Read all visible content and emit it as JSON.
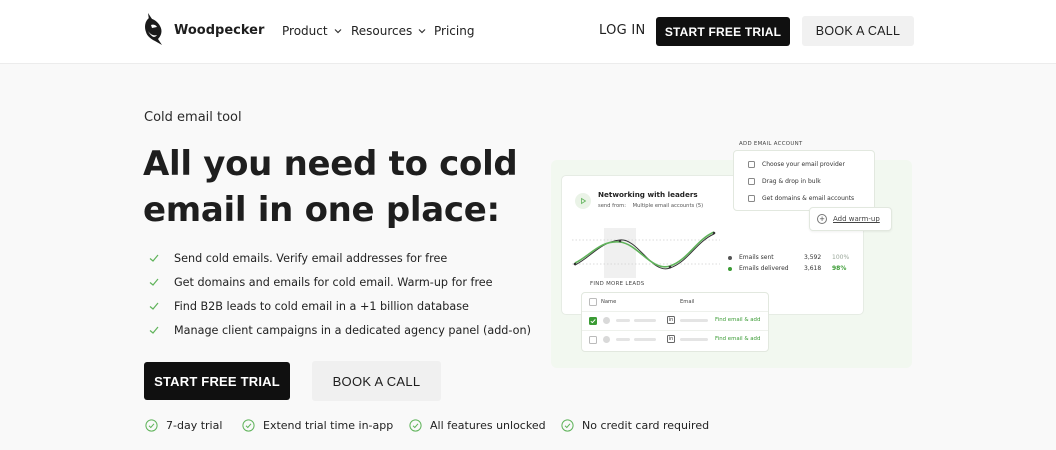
{
  "nav": {
    "brand": "Woodpecker",
    "menu": [
      {
        "label": "Product",
        "dropdown": true
      },
      {
        "label": "Resources",
        "dropdown": true
      },
      {
        "label": "Pricing",
        "dropdown": false
      }
    ],
    "login": "LOG IN",
    "start_trial": "START FREE TRIAL",
    "book_call": "BOOK A CALL"
  },
  "hero": {
    "eyebrow": "Cold email tool",
    "headline_line1": "All you need to cold",
    "headline_line2": "email in one place:",
    "bullets": [
      "Send cold emails. Verify email addresses for free",
      "Get domains and emails for cold email. Warm-up for free",
      "Find B2B leads to cold email in a +1 billion database",
      "Manage client campaigns in a dedicated agency panel (add-on)"
    ],
    "cta_primary": "START FREE TRIAL",
    "cta_secondary": "BOOK A CALL",
    "features": [
      "7-day trial",
      "Extend trial time in-app",
      "All features unlocked",
      "No credit card required"
    ]
  },
  "illustration": {
    "campaign": {
      "title": "Networking with leaders",
      "send_from_label": "send from:",
      "send_from_value": "Multiple email accounts (5)",
      "stats": [
        {
          "label": "Emails sent",
          "value": "3,592",
          "percent": "100%",
          "color": "#555555",
          "pct_color": "#9aa79a"
        },
        {
          "label": "Emails delivered",
          "value": "3,618",
          "percent": "98%",
          "color": "#3a9b34",
          "pct_color": "#3a9b34"
        }
      ]
    },
    "add_account": {
      "title": "ADD EMAIL ACCOUNT",
      "options": [
        "Choose your email provider",
        "Drag & drop in bulk",
        "Get domains & email accounts"
      ],
      "warmup_button": "Add warm-up"
    },
    "leads": {
      "title": "FIND MORE LEADS",
      "col_name": "Name",
      "col_email": "Email",
      "rows": [
        {
          "checked": true,
          "linkedin": "in",
          "action": "Find email & add"
        },
        {
          "checked": false,
          "linkedin": "in",
          "action": "Find email & add"
        }
      ]
    }
  },
  "colors": {
    "accent": "#3a9b34",
    "dark_button": "#101010",
    "light_button": "#f1f1f1",
    "illustration_bg": "#f2f8f0"
  },
  "icons": {
    "logo": "woodpecker-bird-icon",
    "bullet": "check-icon",
    "feature": "check-circle-icon",
    "dropdown": "chevron-down-icon"
  }
}
